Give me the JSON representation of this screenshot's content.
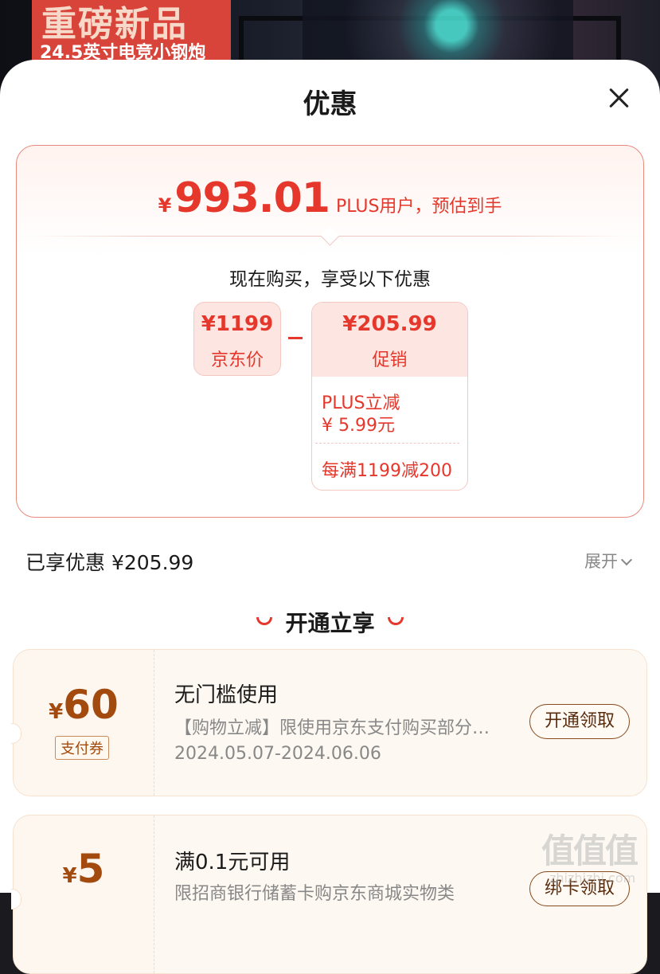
{
  "banner": {
    "headline": "重磅新品",
    "subline": "24.5英寸电竞小钢炮"
  },
  "sheet": {
    "title": "优惠"
  },
  "calc": {
    "final_yen": "¥",
    "final_price": "993.01",
    "final_note": "PLUS用户，预估到手",
    "enjoy_title": "现在购买，享受以下优惠",
    "jd_price_amount": "¥1199",
    "jd_price_label": "京东价",
    "minus": "-",
    "promo_amount": "¥205.99",
    "promo_label": "促销",
    "promo_plus_label": "PLUS立减",
    "promo_plus_value": "¥ 5.99元",
    "promo_full_reduction": "每满1199减200"
  },
  "enjoyed": {
    "label": "已享优惠 ¥205.99",
    "expand_label": "展开"
  },
  "section": {
    "title": "开通立享"
  },
  "coupons": [
    {
      "yen": "¥",
      "amount": "60",
      "tag": "支付券",
      "title": "无门槛使用",
      "desc": "【购物立减】限使用京东支付购买部分…",
      "date": "2024.05.07-2024.06.06",
      "button": "开通领取"
    },
    {
      "yen": "¥",
      "amount": "5",
      "title": "满0.1元可用",
      "desc": "限招商银行储蓄卡购京东商城实物类",
      "button": "绑卡领取"
    }
  ],
  "watermark": {
    "logo": "值值值",
    "text": "zhizhizhi.com"
  },
  "colors": {
    "accent_red": "#e5372b",
    "coupon_brown": "#a34a0e",
    "promo_bg": "#fde6e1"
  }
}
